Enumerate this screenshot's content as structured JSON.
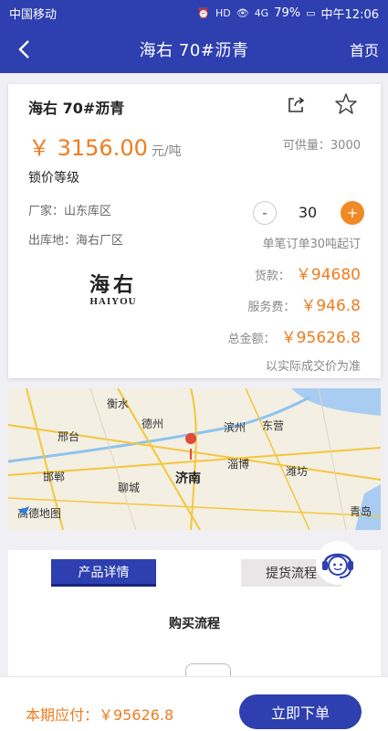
{
  "status_bar": {
    "carrier": "中国移动",
    "battery": "79%",
    "time": "中午12:06",
    "hd": "HD",
    "signal": "4G"
  },
  "nav": {
    "title": "海右 70#沥青",
    "home": "首页"
  },
  "product": {
    "name": "海右 70#沥青",
    "price": "￥ 3156.00",
    "price_unit": "元/吨",
    "stock": "可供量：3000",
    "lock_label": "锁价等级",
    "vendor": "厂家：山东库区",
    "warehouse": "出库地：海右厂区",
    "quantity": "30",
    "min_order": "单笔订单30吨起订",
    "logo_cn": "海右",
    "logo_en": "HAIYOU",
    "goods_label": "货款：",
    "goods_value": "￥94680",
    "fee_label": "服务费：",
    "fee_value": "￥946.8",
    "total_label": "总金额：",
    "total_value": "￥95626.8",
    "note": "以实际成交价为准"
  },
  "map": {
    "cities": [
      "衡水",
      "德州",
      "滨州",
      "东营",
      "邢台",
      "济南",
      "淄博",
      "潍坊",
      "邯郸",
      "聊城",
      "青岛"
    ],
    "logo": "高德地图"
  },
  "tabs": {
    "detail": "产品详情",
    "flow": "提货流程"
  },
  "section": {
    "buy_flow": "购买流程"
  },
  "bottom": {
    "pay": "本期应付：￥95626.8",
    "order_button": "立即下单"
  },
  "colors": {
    "primary": "#2e3fb0",
    "accent": "#ef7c20"
  }
}
